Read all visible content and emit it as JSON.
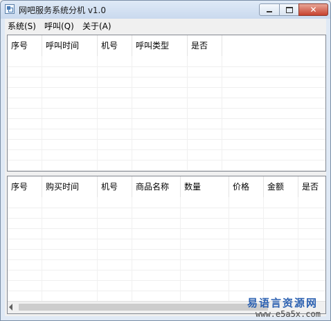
{
  "window": {
    "title": "网吧服务系统分机 v1.0",
    "controls": {
      "minimize_icon": "minimize-icon",
      "maximize_icon": "maximize-icon",
      "close_icon": "close-icon",
      "close_glyph": "✕"
    }
  },
  "menu": {
    "items": [
      {
        "label": "系统(S)"
      },
      {
        "label": "呼叫(Q)"
      },
      {
        "label": "关于(A)"
      }
    ]
  },
  "call_table": {
    "headers": [
      "序号",
      "呼叫时间",
      "机号",
      "呼叫类型",
      "是否"
    ],
    "rows": []
  },
  "purchase_table": {
    "headers": [
      "序号",
      "购买时间",
      "机号",
      "商品名称",
      "数量",
      "价格",
      "金额",
      "是否"
    ],
    "rows": []
  },
  "watermark": {
    "line1": "易语言资源网",
    "line2": "www.e5a5x.com"
  },
  "colors": {
    "title_bar": "#c9d9ee",
    "close_button": "#c7432f",
    "grid_border": "#828790",
    "watermark": "#2c61b1"
  }
}
